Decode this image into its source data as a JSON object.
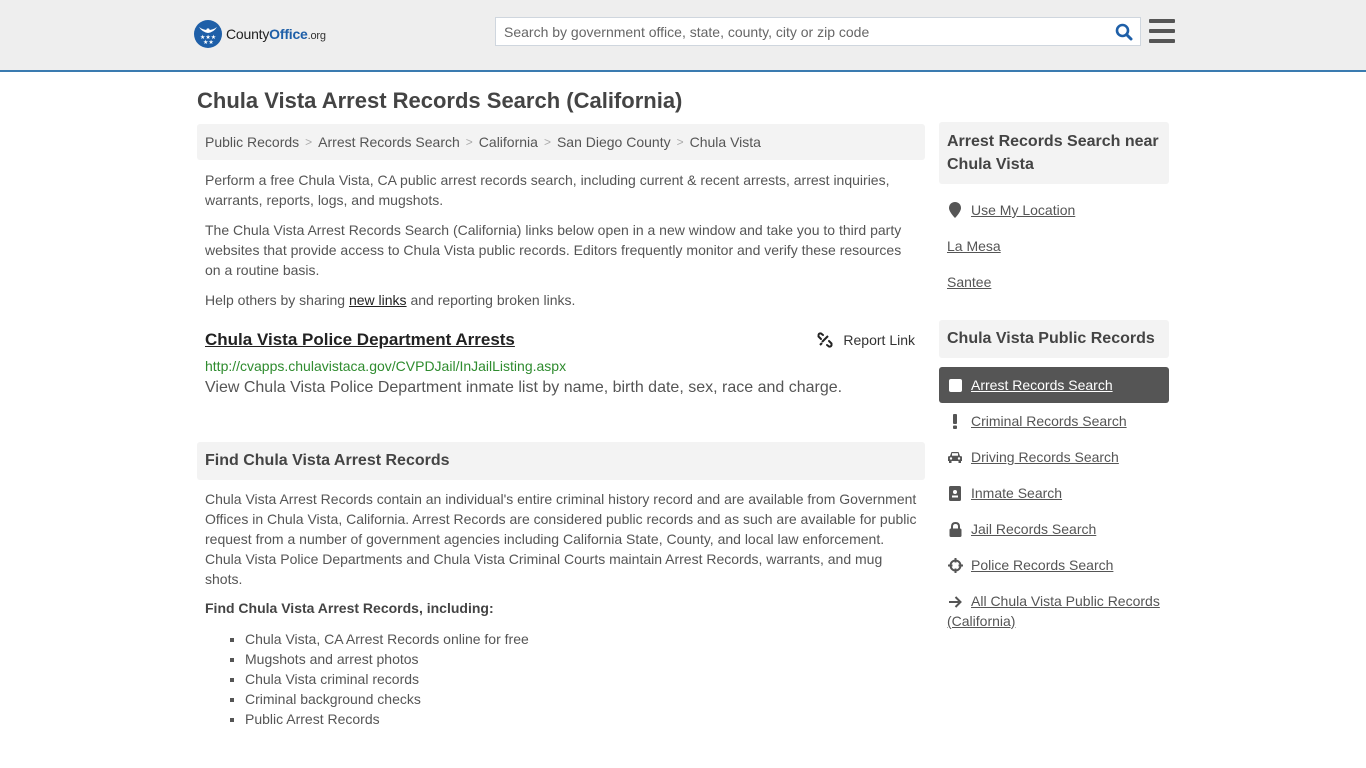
{
  "header": {
    "logo": {
      "county": "County",
      "office": "Office",
      "org": ".org"
    },
    "search_placeholder": "Search by government office, state, county, city or zip code",
    "search_icon": "search-icon",
    "menu_icon": "hamburger-menu-icon"
  },
  "page_title": "Chula Vista Arrest Records Search (California)",
  "breadcrumb": [
    {
      "label": "Public Records"
    },
    {
      "label": "Arrest Records Search"
    },
    {
      "label": "California"
    },
    {
      "label": "San Diego County"
    },
    {
      "label": "Chula Vista"
    }
  ],
  "intro": {
    "p1": "Perform a free Chula Vista, CA public arrest records search, including current & recent arrests, arrest inquiries, warrants, reports, logs, and mugshots.",
    "p2": "The Chula Vista Arrest Records Search (California) links below open in a new window and take you to third party websites that provide access to Chula Vista public records. Editors frequently monitor and verify these resources on a routine basis.",
    "p3_before": "Help others by sharing ",
    "p3_link": "new links",
    "p3_after": " and reporting broken links."
  },
  "result": {
    "title": "Chula Vista Police Department Arrests",
    "url": "http://cvapps.chulavistaca.gov/CVPDJail/InJailListing.aspx",
    "description": "View Chula Vista Police Department inmate list by name, birth date, sex, race and charge.",
    "report_label": "Report Link"
  },
  "find_section": {
    "heading": "Find Chula Vista Arrest Records",
    "body": "Chula Vista Arrest Records contain an individual's entire criminal history record and are available from Government Offices in Chula Vista, California. Arrest Records are considered public records and as such are available for public request from a number of government agencies including California State, County, and local law enforcement. Chula Vista Police Departments and Chula Vista Criminal Courts maintain Arrest Records, warrants, and mug shots.",
    "subheading": "Find Chula Vista Arrest Records, including:",
    "bullets": [
      "Chula Vista, CA Arrest Records online for free",
      "Mugshots and arrest photos",
      "Chula Vista criminal records",
      "Criminal background checks",
      "Public Arrest Records"
    ]
  },
  "sidebar_nearby": {
    "heading": "Arrest Records Search near Chula Vista",
    "items": [
      {
        "label": "Use My Location",
        "icon": "map-pin-icon"
      },
      {
        "label": "La Mesa"
      },
      {
        "label": "Santee"
      }
    ]
  },
  "sidebar_public_records": {
    "heading": "Chula Vista Public Records",
    "items": [
      {
        "label": "Arrest Records Search",
        "icon": "square-icon",
        "active": true
      },
      {
        "label": "Criminal Records Search",
        "icon": "exclamation-icon"
      },
      {
        "label": "Driving Records Search",
        "icon": "car-icon"
      },
      {
        "label": "Inmate Search",
        "icon": "id-badge-icon"
      },
      {
        "label": "Jail Records Search",
        "icon": "lock-icon"
      },
      {
        "label": "Police Records Search",
        "icon": "crosshair-icon"
      },
      {
        "label": "All Chula Vista Public Records (California)",
        "icon": "arrow-right-icon"
      }
    ]
  },
  "colors": {
    "brand_blue": "#1e5fa8",
    "header_border": "#3a7bb0",
    "url_green": "#2e8b2e",
    "active_bg": "#555555"
  }
}
